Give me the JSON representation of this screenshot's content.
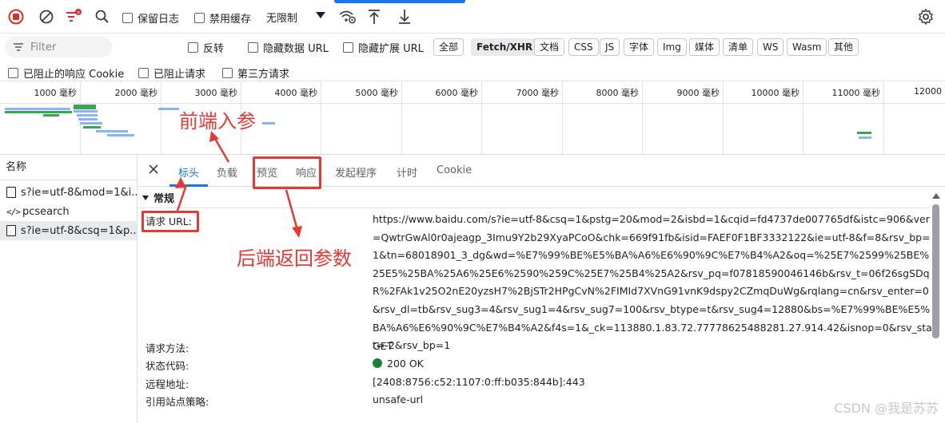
{
  "toolbar": {
    "preserve_log_label": "保留日志",
    "disable_cache_label": "禁用缓存",
    "throttle_value": "无限制"
  },
  "filter_bar": {
    "filter_placeholder": "Filter",
    "invert_label": "反转",
    "hide_data_url_label": "隐藏数据 URL",
    "hide_ext_url_label": "隐藏扩展 URL",
    "type_buttons": [
      "全部",
      "Fetch/XHR",
      "文档",
      "CSS",
      "JS",
      "字体",
      "Img",
      "媒体",
      "清单",
      "WS",
      "Wasm",
      "其他"
    ],
    "active_type": "Fetch/XHR"
  },
  "options_bar": {
    "blocked_cookies_label": "已阻止的响应 Cookie",
    "blocked_requests_label": "已阻止请求",
    "third_party_label": "第三方请求"
  },
  "overview": {
    "ticks": [
      "1000 毫秒",
      "2000 毫秒",
      "3000 毫秒",
      "4000 毫秒",
      "5000 毫秒",
      "6000 毫秒",
      "7000 毫秒",
      "8000 毫秒",
      "9000 毫秒",
      "10000 毫秒",
      "11000 毫秒",
      "12000"
    ]
  },
  "request_list": {
    "header": "名称",
    "items": [
      {
        "name": "s?ie=utf-8&mod=1&i...",
        "icon": "document-icon"
      },
      {
        "name": "pcsearch",
        "icon": "fetch-icon"
      },
      {
        "name": "s?ie=utf-8&csq=1&p...",
        "icon": "document-icon"
      }
    ]
  },
  "detail_tabs": [
    "标头",
    "负载",
    "预览",
    "响应",
    "发起程序",
    "计时",
    "Cookie"
  ],
  "general": {
    "section_title": "常规",
    "url_key": "请求 URL:",
    "url_value": "https://www.baidu.com/s?ie=utf-8&csq=1&pstg=20&mod=2&isbd=1&cqid=fd4737de007765df&istc=906&ver=QwtrGwAl0r0ajeagp_3Imu9Y2b29XyaPCoO&chk=669f91fb&isid=FAEF0F1BF3332122&ie=utf-8&f=8&rsv_bp=1&tn=68018901_3_dg&wd=%E7%99%BE%E5%BA%A6%E6%90%9C%E7%B4%A2&oq=%25E7%2599%25BE%25E5%25BA%25A6%25E6%2590%259C%25E7%25B4%25A2&rsv_pq=f07818590046146b&rsv_t=06f26sgSDqR%2FAk1v25O2nE20yzsH7%2BjSTr2HPgCvN%2FIMId7XVnG91vnK9dspy2CZmqDuWg&rqlang=cn&rsv_enter=0&rsv_dl=tb&rsv_sug3=4&rsv_sug1=4&rsv_sug7=100&rsv_btype=t&rsv_sug4=12880&bs=%E7%99%BE%E5%BA%A6%E6%90%9C%E7%B4%A2&f4s=1&_ck=113880.1.83.72.77778625488281.27.914.42&isnop=0&rsv_stat=-2&rsv_bp=1",
    "method_key": "请求方法:",
    "method_value": "GET",
    "status_key": "状态代码:",
    "status_value": "200 OK",
    "remote_key": "远程地址:",
    "remote_value": "[2408:8756:c52:1107:0:ff:b035:844b]:443",
    "referrer_key": "引用站点策略:",
    "referrer_value": "unsafe-url"
  },
  "annotations": {
    "front_params": "前端入参",
    "backend_return": "后端返回参数",
    "color": "#e53935"
  },
  "watermark": "CSDN @我是苏苏"
}
